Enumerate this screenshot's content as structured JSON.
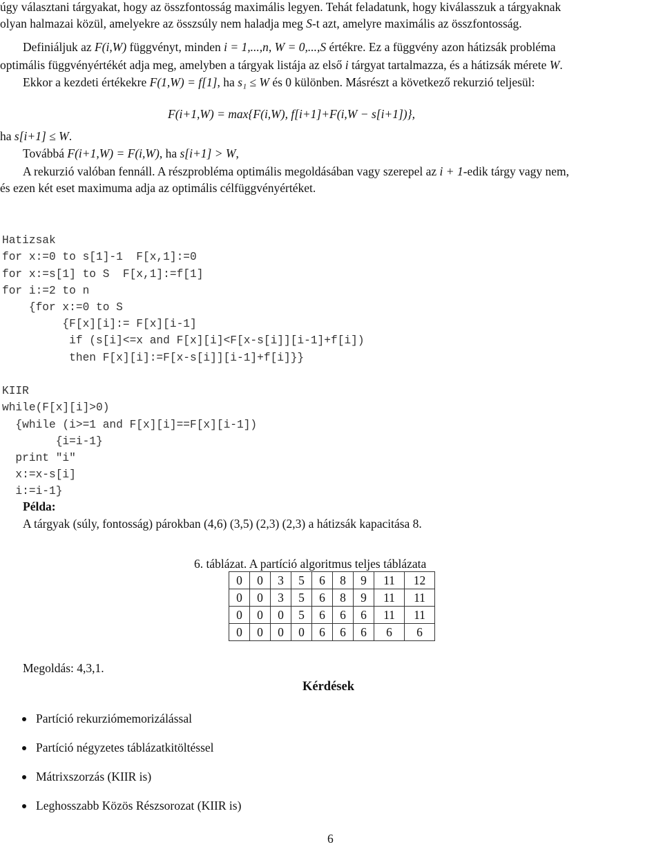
{
  "intro": {
    "line1": "úgy választani tárgyakat, hogy az összfontosság maximális legyen. Tehát feladatunk, hogy kiválasszuk a tárgyaknak",
    "line2_a": "olyan halmazai közül, amelyekre az összsúly nem haladja meg ",
    "line2_var": "S",
    "line2_b": "-t azt, amelyre maximális az összfontosság."
  },
  "definition": {
    "p1_a": "Definiáljuk az ",
    "p1_math1": "F(i,W)",
    "p1_b": " függvényt, minden ",
    "p1_math2": "i = 1,...,n, W = 0,...,S",
    "p1_c": " értékre. Ez a függvény azon hátizsák probléma",
    "p2_a": "optimális függvényértékét adja meg, amelyben a tárgyak listája az első ",
    "p2_var": "i",
    "p2_b": " tárgyat tartalmazza, és a hátizsák mérete ",
    "p2_var2": "W",
    "p2_c": ".",
    "p3_a": "Ekkor a kezdeti értékekre ",
    "p3_math": "F(1,W) = f[1]",
    "p3_b": ", ha ",
    "p3_math2": "s₁ ≤ W",
    "p3_c": " és 0 különben. Másrészt a következő rekurzió teljesül:"
  },
  "formula": "F(i+1,W) = max{F(i,W), f[i+1]+F(i,W − s[i+1])},",
  "condition": {
    "a": "ha ",
    "math": "s[i+1] ≤ W",
    "b": "."
  },
  "furthermore": {
    "a": "Továbbá ",
    "math": "F(i+1,W) = F(i,W)",
    "b": ", ha ",
    "math2": "s[i+1] > W",
    "c": ","
  },
  "explanation": {
    "line1_a": "A rekurzió valóban fennáll. A részprobléma optimális megoldásában vagy szerepel az ",
    "line1_math": "i + 1",
    "line1_b": "-edik tárgy vagy nem,",
    "line2": "és ezen két eset maximuma adja az optimális célfüggvényértéket."
  },
  "code_hatizsak": [
    "Hatizsak",
    "for x:=0 to s[1]-1  F[x,1]:=0",
    "for x:=s[1] to S  F[x,1]:=f[1]",
    "for i:=2 to n",
    "    {for x:=0 to S",
    "         {F[x][i]:= F[x][i-1]",
    "          if (s[i]<=x and F[x][i]<F[x-s[i]][i-1]+f[i])",
    "          then F[x][i]:=F[x-s[i]][i-1]+f[i]}}"
  ],
  "code_kiir": [
    "KIIR",
    "while(F[x][i]>0)",
    "  {while (i>=1 and F[x][i]==F[x][i-1])",
    "        {i=i-1}",
    "  print \"i\"",
    "  x:=x-s[i]",
    "  i:=i-1}"
  ],
  "example": {
    "heading": "Példa:",
    "text": "A tárgyak (súly, fontosság) párokban (4,6) (3,5) (2,3) (2,3) a hátizsák kapacitása 8."
  },
  "table": {
    "caption": "6. táblázat. A partíció algoritmus teljes táblázata",
    "rows": [
      [
        "0",
        "0",
        "3",
        "5",
        "6",
        "8",
        "9",
        "11",
        "12"
      ],
      [
        "0",
        "0",
        "3",
        "5",
        "6",
        "8",
        "9",
        "11",
        "11"
      ],
      [
        "0",
        "0",
        "0",
        "5",
        "6",
        "6",
        "6",
        "11",
        "11"
      ],
      [
        "0",
        "0",
        "0",
        "0",
        "6",
        "6",
        "6",
        "6",
        "6"
      ]
    ]
  },
  "solution": "Megoldás: 4,3,1.",
  "questions": {
    "heading": "Kérdések",
    "items": [
      "Partíció rekurziómemorizálással",
      "Partíció négyzetes táblázatkitöltéssel",
      "Mátrixszorzás (KIIR is)",
      "Leghosszabb Közös Részsorozat (KIIR is)"
    ]
  },
  "page_number": "6"
}
